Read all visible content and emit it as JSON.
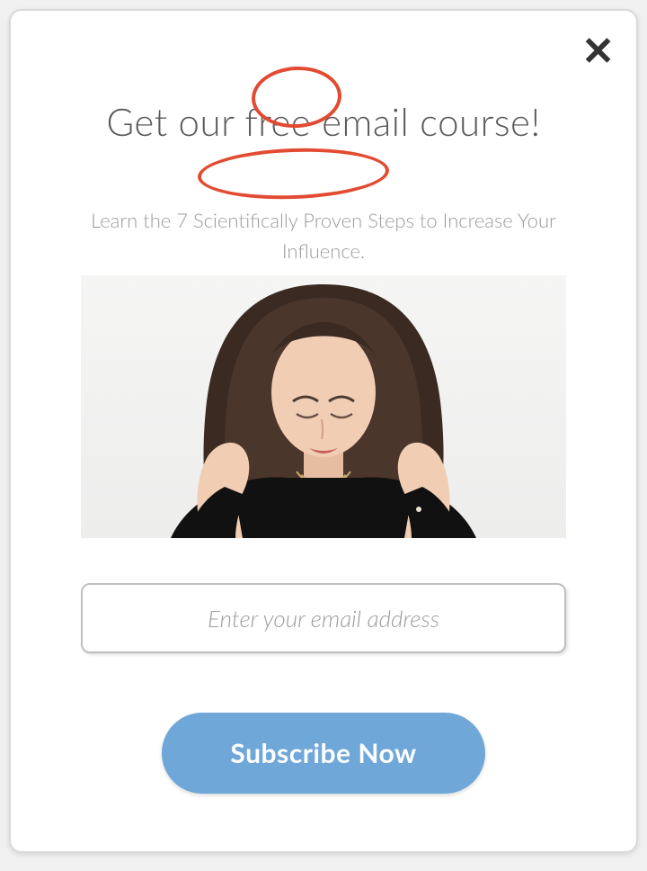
{
  "heading_parts": {
    "before": "Get our ",
    "free": "free",
    "after": " email course!"
  },
  "subheading_parts": {
    "before": "Learn the 7 ",
    "highlight": "Scientifically Proven",
    "after": " Steps to Increase Your Influence."
  },
  "email_placeholder": "Enter your email address",
  "subscribe_label": "Subscribe Now",
  "close_glyph": "✕",
  "colors": {
    "accent_circle": "#e24a31",
    "button_bg": "#6fa7d9"
  }
}
